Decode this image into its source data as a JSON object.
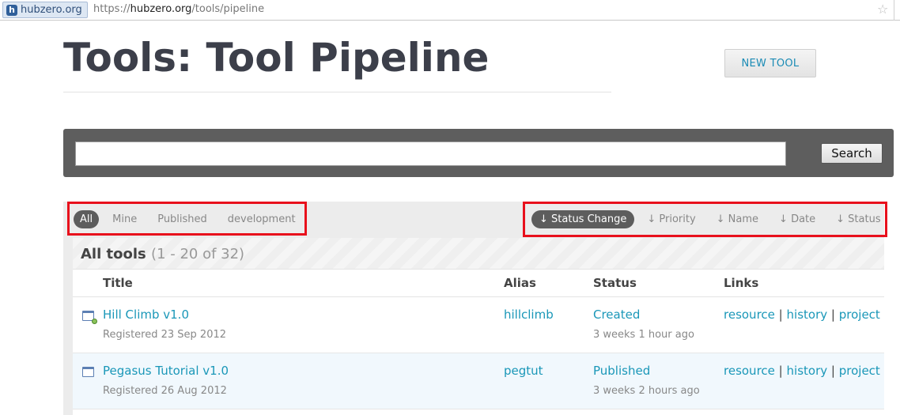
{
  "browser": {
    "site_label": "hubzero.org",
    "url_prefix": "https://",
    "url_host": "hubzero.org",
    "url_path": "/tools/pipeline"
  },
  "header": {
    "title": "Tools: Tool Pipeline",
    "new_tool_label": "NEW TOOL"
  },
  "search": {
    "value": "",
    "button_label": "Search"
  },
  "filters": [
    {
      "label": "All",
      "active": true
    },
    {
      "label": "Mine",
      "active": false
    },
    {
      "label": "Published",
      "active": false
    },
    {
      "label": "development",
      "active": false
    }
  ],
  "sorts": [
    {
      "label": "↓ Status Change",
      "active": true
    },
    {
      "label": "↓ Priority",
      "active": false
    },
    {
      "label": "↓ Name",
      "active": false
    },
    {
      "label": "↓ Date",
      "active": false
    },
    {
      "label": "↓ Status",
      "active": false
    }
  ],
  "table": {
    "caption": "All tools",
    "count": "(1 - 20 of 32)",
    "columns": [
      "Title",
      "Alias",
      "Status",
      "Links"
    ],
    "rows": [
      {
        "title": "Hill Climb v1.0",
        "registered": "Registered 23 Sep 2012",
        "alias": "hillclimb",
        "status": "Created",
        "status_time": "3 weeks 1 hour ago",
        "links": [
          "resource",
          "history",
          "project"
        ]
      },
      {
        "title": "Pegasus Tutorial v1.0",
        "registered": "Registered 26 Aug 2012",
        "alias": "pegtut",
        "status": "Published",
        "status_time": "3 weeks 2 hours ago",
        "links": [
          "resource",
          "history",
          "project"
        ]
      }
    ],
    "link_separator": "|"
  },
  "colors": {
    "link": "#1a97b8",
    "highlight_box": "#e8101c",
    "active_pill": "#5d5d5d"
  }
}
